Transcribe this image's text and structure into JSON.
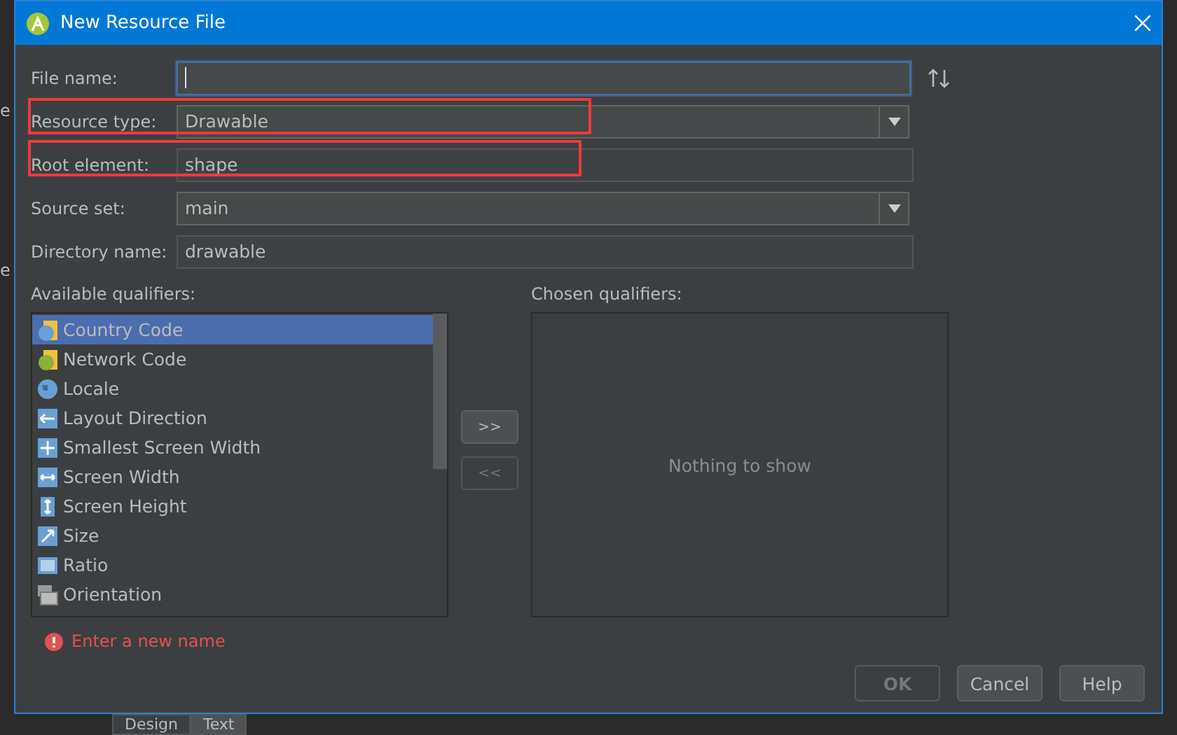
{
  "window": {
    "title": "New Resource File"
  },
  "background": {
    "side_fragments": [
      "e",
      "e"
    ],
    "tabs": [
      {
        "label": "Design",
        "selected": false
      },
      {
        "label": "Text",
        "selected": true
      }
    ]
  },
  "form": [
    {
      "label": "File name:",
      "kind": "text",
      "focused": true
    },
    {
      "label": "Resource type:",
      "kind": "combo",
      "value": "Drawable",
      "highlighted": true
    },
    {
      "label": "Root element:",
      "kind": "readonly",
      "value": "shape",
      "highlighted": true
    },
    {
      "label": "Source set:",
      "kind": "combo",
      "value": "main"
    },
    {
      "label": "Directory name:",
      "kind": "readonly",
      "value": "drawable"
    }
  ],
  "available": {
    "label": "Available qualifiers:",
    "items": [
      {
        "label": "Country Code",
        "selected": true
      },
      {
        "label": "Network Code",
        "selected": false
      },
      {
        "label": "Locale",
        "selected": false
      },
      {
        "label": "Layout Direction",
        "selected": false
      },
      {
        "label": "Smallest Screen Width",
        "selected": false
      },
      {
        "label": "Screen Width",
        "selected": false
      },
      {
        "label": "Screen Height",
        "selected": false
      },
      {
        "label": "Size",
        "selected": false
      },
      {
        "label": "Ratio",
        "selected": false
      },
      {
        "label": "Orientation",
        "selected": false
      }
    ]
  },
  "transfer": [
    {
      "label": ">>",
      "disabled": false
    },
    {
      "label": "<<",
      "disabled": true
    }
  ],
  "chosen": {
    "label": "Chosen qualifiers:",
    "empty_text": "Nothing to show"
  },
  "error": "Enter a new name",
  "buttons": [
    {
      "label": "OK",
      "disabled": true
    },
    {
      "label": "Cancel",
      "disabled": false
    },
    {
      "label": "Help",
      "disabled": false
    }
  ]
}
